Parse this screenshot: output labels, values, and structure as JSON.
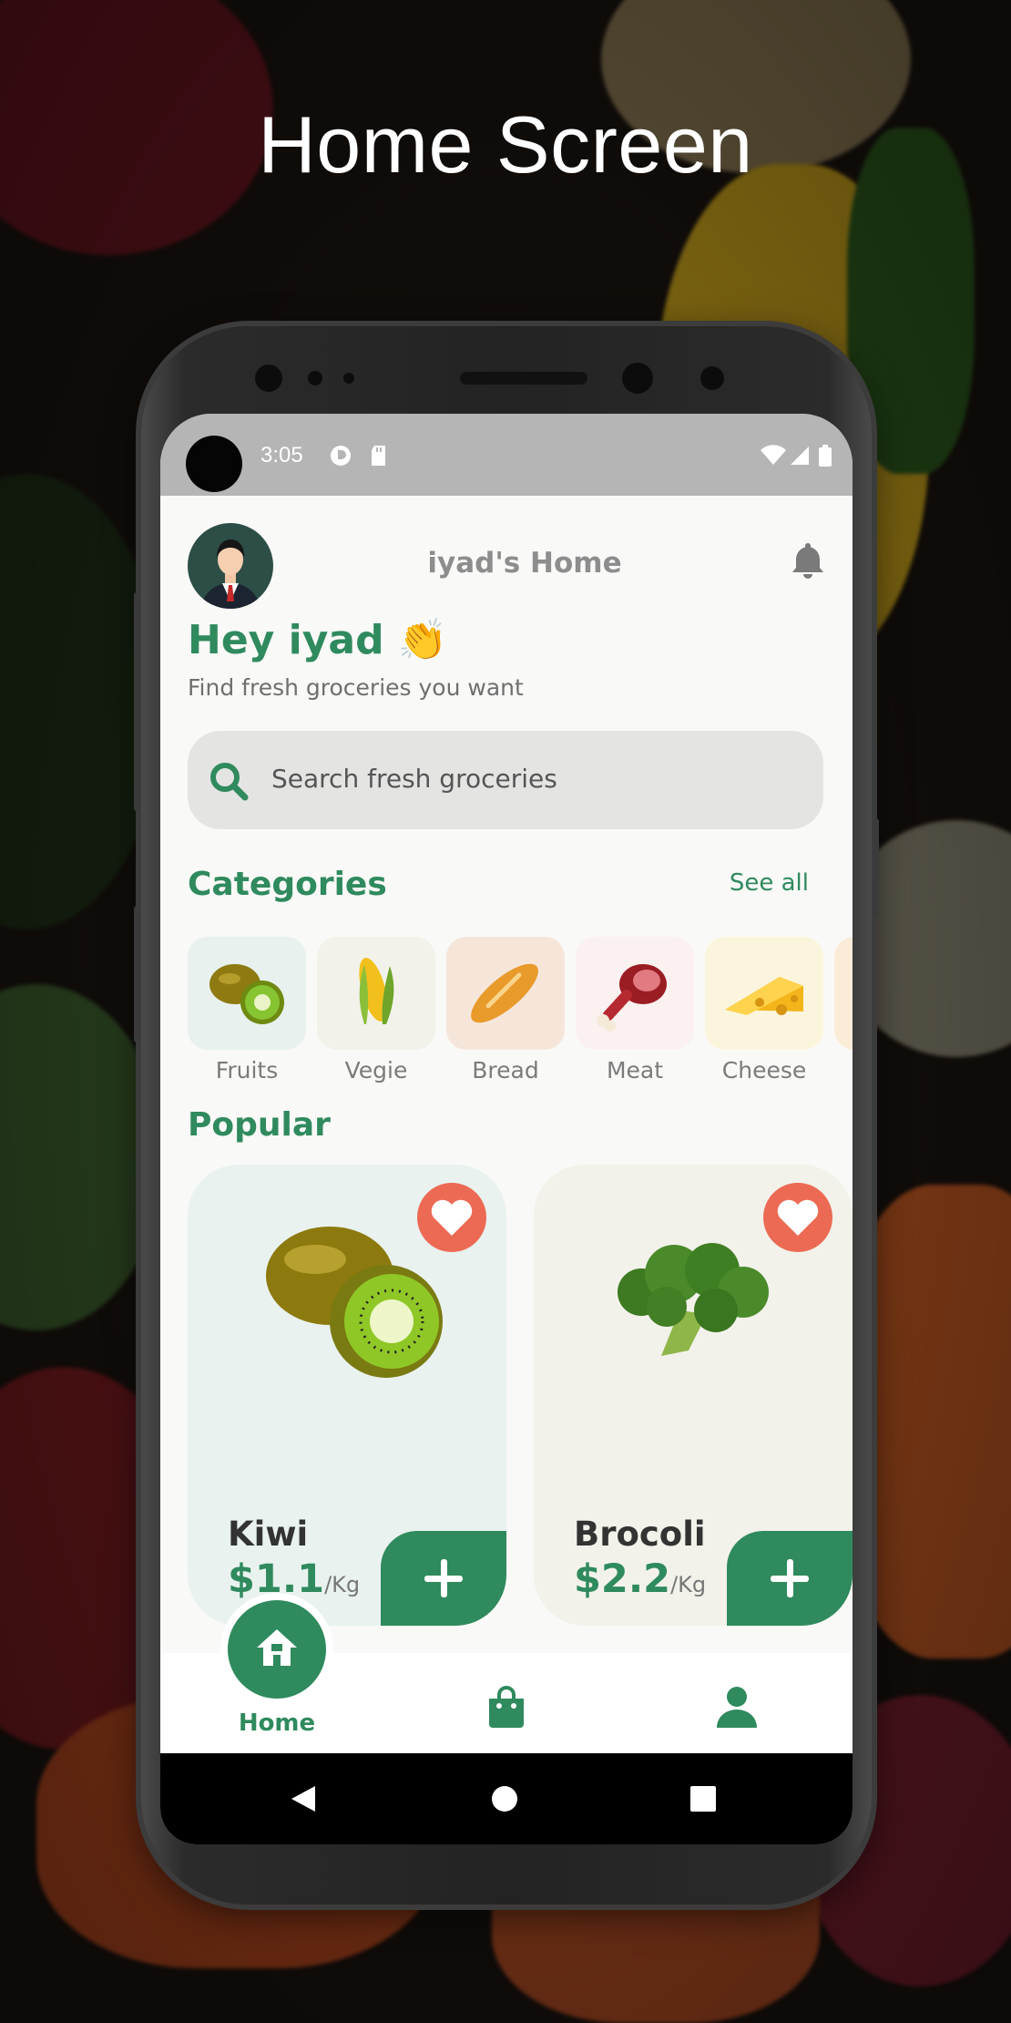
{
  "headline": "Home Screen",
  "status_bar": {
    "time": "3:05",
    "icons": [
      "media-icon",
      "sd-card-icon",
      "wifi-icon",
      "signal-icon",
      "battery-icon"
    ]
  },
  "header": {
    "title": "iyad's Home",
    "avatar": "avatar",
    "notification_icon": "bell-icon"
  },
  "greeting": {
    "title": "Hey iyad 👏",
    "subtitle": "Find fresh groceries you want"
  },
  "search": {
    "placeholder": "Search fresh groceries"
  },
  "categories": {
    "title": "Categories",
    "see_all": "See all",
    "items": [
      {
        "label": "Fruits",
        "icon": "kiwi-icon",
        "tile_color": "#e8f1ee"
      },
      {
        "label": "Vegie",
        "icon": "corn-icon",
        "tile_color": "#f2f2ea"
      },
      {
        "label": "Bread",
        "icon": "bread-icon",
        "tile_color": "#f6e6da"
      },
      {
        "label": "Meat",
        "icon": "meat-icon",
        "tile_color": "#fbf1f0"
      },
      {
        "label": "Cheese",
        "icon": "cheese-icon",
        "tile_color": "#fbf5dd"
      }
    ]
  },
  "popular": {
    "title": "Popular",
    "items": [
      {
        "name": "Kiwi",
        "price": "$1.1",
        "unit": "/Kg",
        "card_color": "#e9f2ef"
      },
      {
        "name": "Brocoli",
        "price": "$2.2",
        "unit": "/Kg",
        "card_color": "#f2f2ea"
      }
    ]
  },
  "bottom_nav": {
    "home_label": "Home",
    "items": [
      "home-icon",
      "shopping-bag-icon",
      "profile-icon"
    ]
  },
  "colors": {
    "primary": "#2f8a5d",
    "favorite": "#ec6a54",
    "background": "#f9f9f7"
  }
}
